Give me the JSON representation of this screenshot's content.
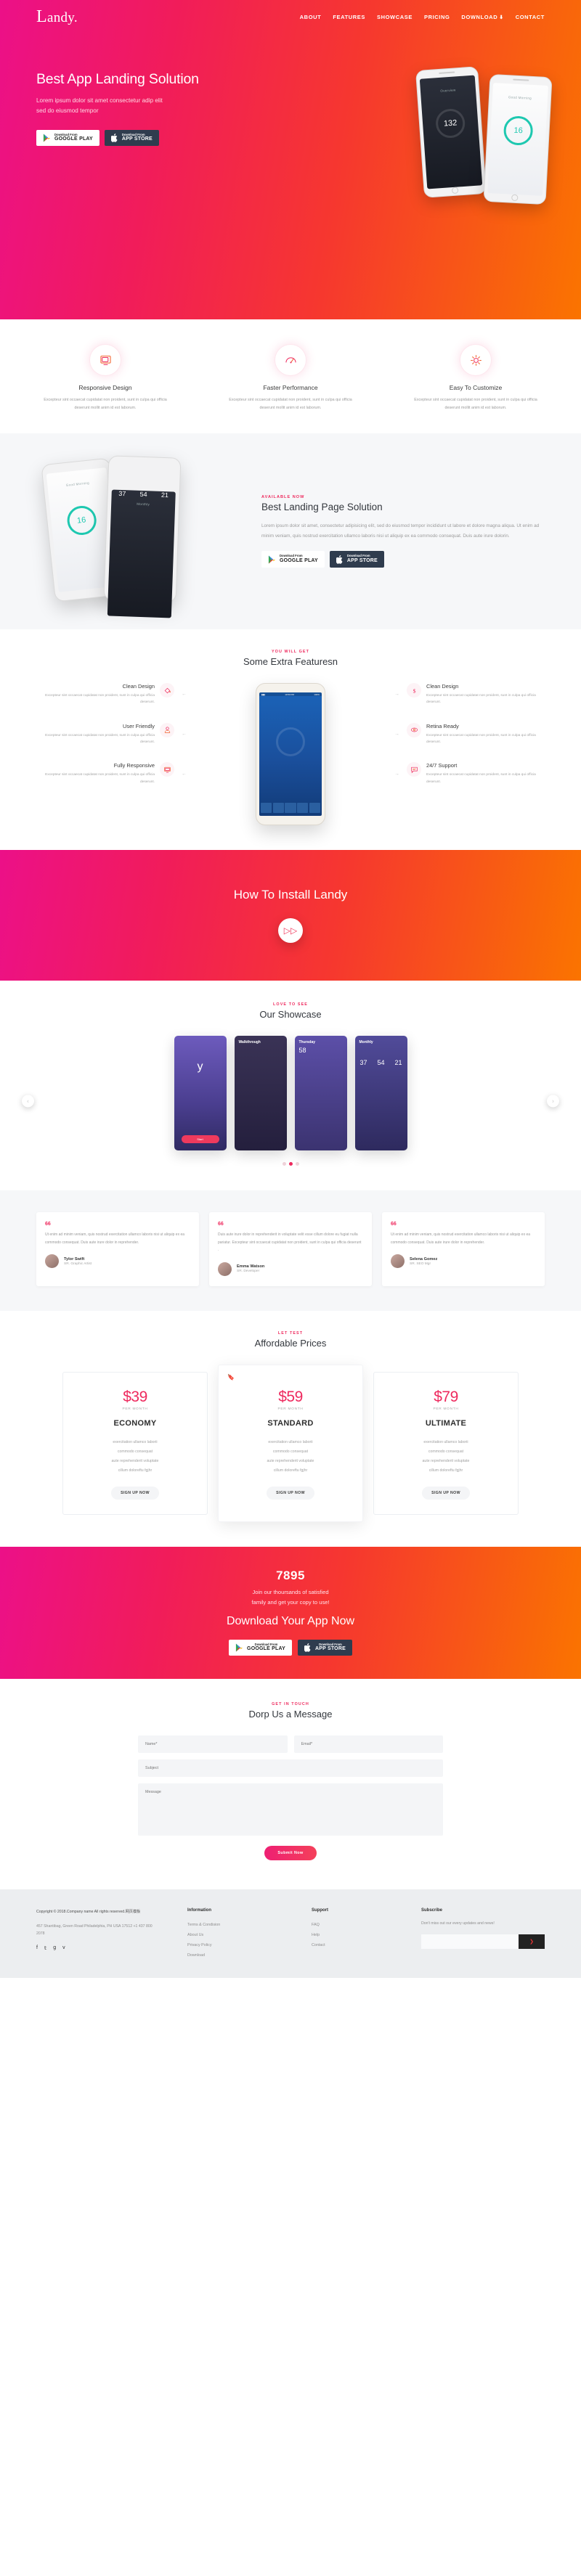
{
  "brand": {
    "logo_first": "L",
    "logo_rest": "andy."
  },
  "nav": {
    "items": [
      "ABOUT",
      "FEATURES",
      "SHOWCASE",
      "PRICING",
      "DOWNLOAD",
      "CONTACT"
    ],
    "download_icon": "download-icon"
  },
  "hero": {
    "title": "Best App Landing Solution",
    "subtitle_line1": "Lorem ipsum dolor sit amet consectetur adip elit",
    "subtitle_line2": "sed do eiusmod tempor",
    "google": {
      "small": "Download From",
      "big": "GOOGLE PLAY"
    },
    "apple": {
      "small": "Download From",
      "big": "APP STORE"
    },
    "phone_left_label": "Overview",
    "phone_left_value": "132",
    "phone_right_label": "Good Morning",
    "phone_right_value": "16"
  },
  "features3": [
    {
      "icon": "monitor-icon",
      "title": "Responsive Design",
      "desc": "Excepteur sint occaecat cupidatat non proident, sunt in culpa qui officia deserunt mollit anim id est laborum."
    },
    {
      "icon": "speedometer-icon",
      "title": "Faster Performance",
      "desc": "Excepteur sint occaecat cupidatat non proident, sunt in culpa qui officia deserunt mollit anim id est laborum."
    },
    {
      "icon": "gear-icon",
      "title": "Easy To Customize",
      "desc": "Excepteur sint occaecat cupidatat non proident, sunt in culpa qui officia deserunt mollit anim id est laborum."
    }
  ],
  "landing": {
    "eyebrow": "AVAILABLE NOW",
    "title": "Best Landing Page Solution",
    "body": "Lorem ipsum dolor sit amet, consectetur adipisicing elit, sed do eiusmod tempor incididunt ut labore et dolore magna aliqua. Ut enim ad minim veniam, quis nostrud exercitation ullamco laboris nisi ut aliquip ex ea commodo consequat. Duis aute irure dolorin.",
    "google": {
      "small": "Download From",
      "big": "GOOGLE PLAY"
    },
    "apple": {
      "small": "Download From",
      "big": "APP STORE"
    },
    "phone_a_label": "Good Morning",
    "phone_a_value": "16",
    "phone_b_label": "Monthly",
    "phone_b_n1": "37",
    "phone_b_n2": "54",
    "phone_b_n3": "21"
  },
  "extra": {
    "eyebrow": "YOU WILL GET",
    "title": "Some Extra Featuresn",
    "left": [
      {
        "icon": "paint-bucket-icon",
        "title": "Clean Design",
        "desc": "Excepteur sint occaecat cupidatat non proident, sunt in culpa qui officia deserunt."
      },
      {
        "icon": "user-icon",
        "title": "User Friendly",
        "desc": "Excepteur sint occaecat cupidatat non proident, sunt in culpa qui officia deserunt."
      },
      {
        "icon": "monitor-icon",
        "title": "Fully Responsive",
        "desc": "Excepteur sint occaecat cupidatat non proident, sunt in culpa qui officia deserunt."
      }
    ],
    "right": [
      {
        "icon": "dollar-icon",
        "title": "Clean Design",
        "desc": "Excepteur sint occaecat cupidatat non proident, sunt in culpa qui officia deserunt."
      },
      {
        "icon": "eye-icon",
        "title": "Retina Ready",
        "desc": "Excepteur sint occaecat cupidatat non proident, sunt in culpa qui officia deserunt."
      },
      {
        "icon": "chat-icon",
        "title": "24/7 Support",
        "desc": "Excepteur sint occaecat cupidatat non proident, sunt in culpa qui officia deserunt."
      }
    ],
    "phone_time": "10:50 PM",
    "phone_batt": "100%"
  },
  "install": {
    "title": "How To Install Landy",
    "play_icon": "play-icon"
  },
  "showcase": {
    "eyebrow": "LOVE TO SEE",
    "title": "Our Showcase",
    "prev_icon": "chevron-left-icon",
    "next_icon": "chevron-right-icon",
    "cards": [
      {
        "label": "y",
        "cta": "Start"
      },
      {
        "label": "Walkthrough",
        "cta": ""
      },
      {
        "label": "Thursday",
        "temp": "58",
        "cta": ""
      },
      {
        "label": "Monthly",
        "n1": "37",
        "n2": "54",
        "n3": "21",
        "cta": ""
      }
    ],
    "dots": 3,
    "active_dot": 1
  },
  "testimonials": [
    {
      "quote_mark": "66",
      "text": "Ut enim ad minim veniam, quis nostrud exercitation ullamco laboris nisi ut aliquip ex ea commodo consequat. Duis aute irure dolor in reprehender.",
      "name": "Tylor Swift",
      "role": "SR. Graphic Artist"
    },
    {
      "quote_mark": "66",
      "text": "Duis aute irure dolor in reprehenderit in voluptate velit esse cillum dolore eu fugiat nulla pariatur. Excepteur sint occaecat cupidatat non proident, sunt in culpa qui officia deserunt .",
      "name": "Emma Watson",
      "role": "SR. Developer"
    },
    {
      "quote_mark": "66",
      "text": "Ut enim ad minim veniam, quis nostrud exercitation ullamco laboris nisi ut aliquip ex ea commodo consequat. Duis aute irure dolor in reprehender.",
      "name": "Selena Gomez",
      "role": "SR. SEO Mgr"
    }
  ],
  "pricing": {
    "eyebrow": "LET TEST",
    "title": "Affordable Prices",
    "plans": [
      {
        "price": "$39",
        "per": "PER MONTH",
        "name": "ECONOMY",
        "features": [
          "exercitation ullamco laborii",
          "commodo consequat",
          "aute reprehenderit voluptate",
          "cillum doloreftu fgjhr"
        ],
        "cta": "SIGN UP NOW",
        "featured": false
      },
      {
        "price": "$59",
        "per": "PER MONTH",
        "name": "STANDARD",
        "features": [
          "exercitation ullamco laborii",
          "commodo consequat",
          "aute reprehenderit voluptate",
          "cillum doloreftu fgjhr"
        ],
        "cta": "SIGN UP NOW",
        "featured": true,
        "badge_icon": "bookmark-icon"
      },
      {
        "price": "$79",
        "per": "PER MONTH",
        "name": "ULTIMATE",
        "features": [
          "exercitation ullamco laborii",
          "commodo consequat",
          "aute reprehenderit voluptate",
          "cillum doloreftu fgjhr"
        ],
        "cta": "SIGN UP NOW",
        "featured": false
      }
    ]
  },
  "download_cta": {
    "count": "7895",
    "sub_line1": "Join our thoursands of satisfied",
    "sub_line2": "family and get your copy to use!",
    "title": "Download Your App Now",
    "google": {
      "small": "Download From",
      "big": "GOOGLE PLAY"
    },
    "apple": {
      "small": "Download From",
      "big": "APP STORE"
    }
  },
  "contact": {
    "eyebrow": "GET IN TOUCH",
    "title": "Dorp Us a Message",
    "name_placeholder": "Name*",
    "email_placeholder": "Email*",
    "subject_placeholder": "Subject",
    "message_placeholder": "Message",
    "submit": "Submit Now"
  },
  "footer": {
    "copyright": "Copyright © 2018.Company name All rights reserved.网页模板",
    "address": "457 Shantibag, Green Road Philadelphia, PH USA 17512 +1 437 800 2078",
    "social": [
      "f",
      "t",
      "g",
      "v"
    ],
    "information_title": "Information",
    "information_links": [
      "Terms & Condision",
      "About Us",
      "Privacy Policy",
      "Download"
    ],
    "support_title": "Support",
    "support_links": [
      "FAQ",
      "Help",
      "Contact"
    ],
    "subscribe_title": "Subscribe",
    "subscribe_note": "Don't miss out our every updates and news!",
    "subscribe_placeholder": "",
    "subscribe_btn_icon": "arrow-right-icon"
  },
  "colors": {
    "pink": "#ee2a5e",
    "magenta": "#ec1088",
    "orange": "#fa7400",
    "dark": "#2f3c4e"
  }
}
